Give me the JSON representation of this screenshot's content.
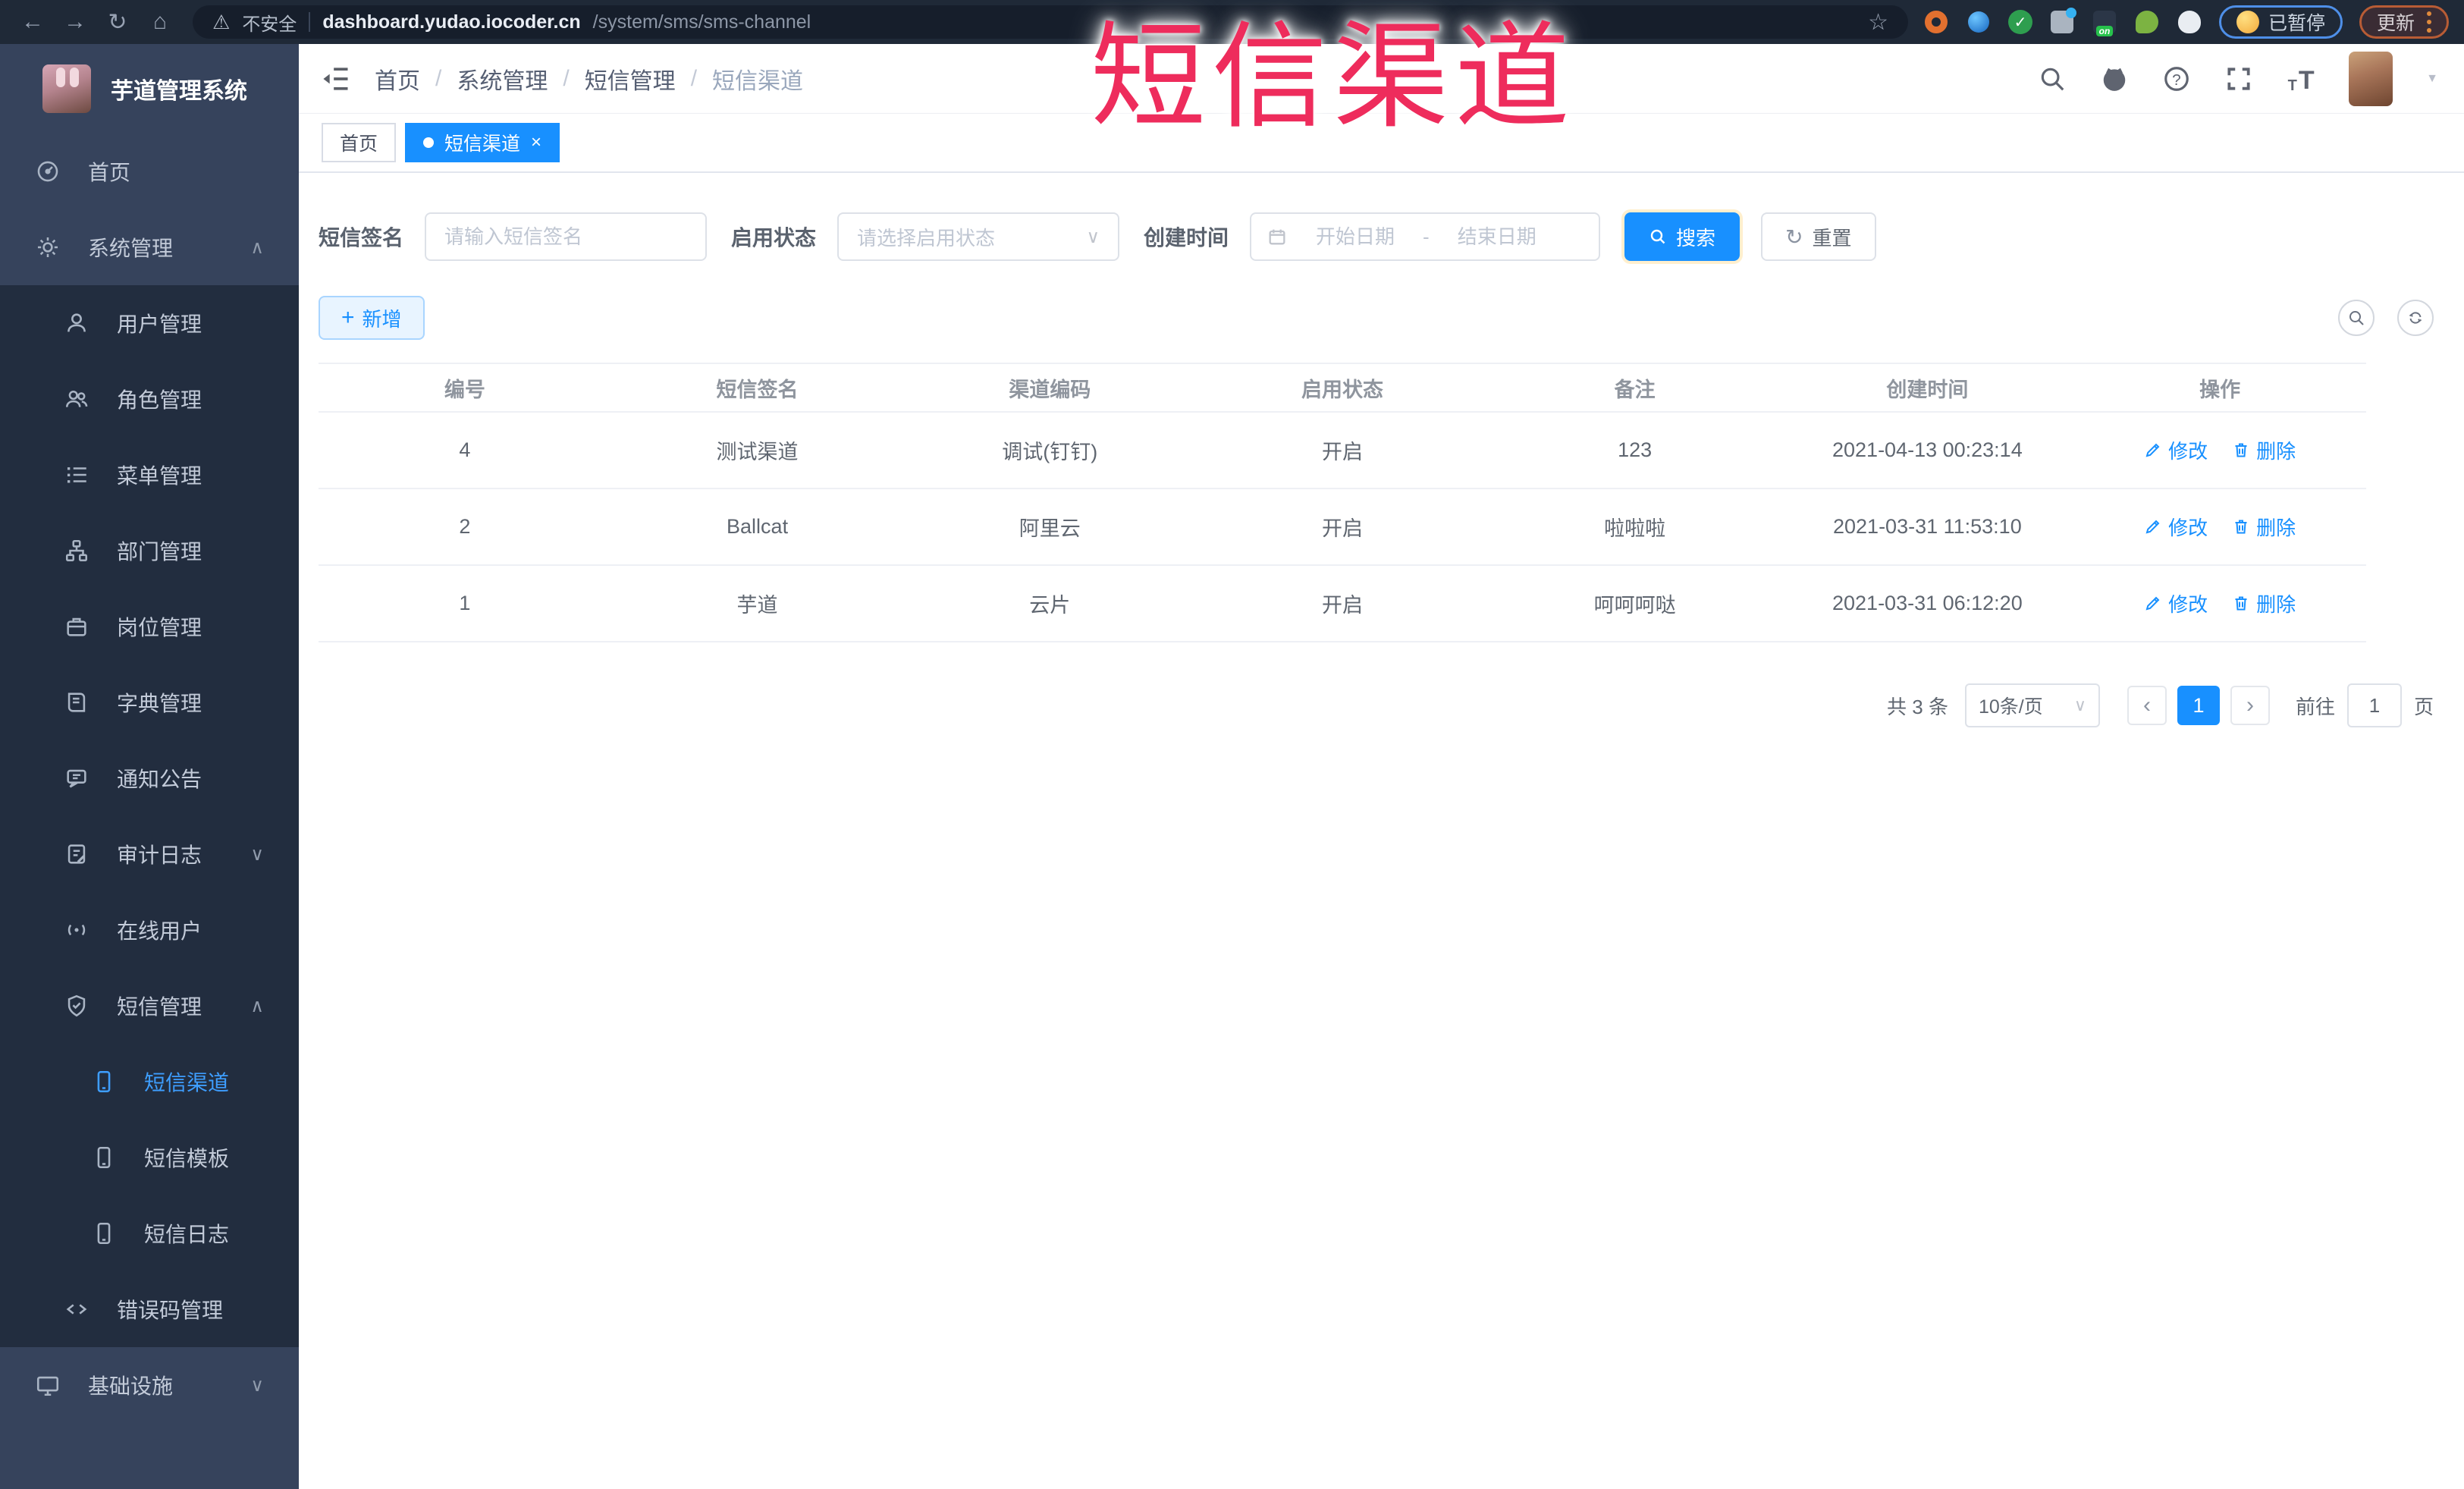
{
  "browser": {
    "security_label": "不安全",
    "url_host": "dashboard.yudao.iocoder.cn",
    "url_path": "/system/sms/sms-channel",
    "paused_badge": "已暂停",
    "update_button": "更新"
  },
  "overlay_title": "短信渠道",
  "icons": {
    "back": "←",
    "forward": "→",
    "reload": "↻",
    "home": "⌂",
    "warning": "⚠",
    "star": "☆",
    "check": "✓",
    "on_badge": "on",
    "caret_up": "∧",
    "caret_down": "∨",
    "select_caret": "∨",
    "close": "×",
    "plus": "+",
    "dash": "-",
    "chevron_left": "‹",
    "chevron_right": "›",
    "avatar_caret": "▼",
    "refresh_glyph": "↻",
    "font_size": "T"
  },
  "sidebar": {
    "app_title": "芋道管理系统",
    "items": [
      {
        "label": "首页",
        "icon": "dashboard",
        "level": 1,
        "dark": false,
        "caret": "",
        "active": false
      },
      {
        "label": "系统管理",
        "icon": "gear",
        "level": 1,
        "dark": false,
        "caret": "up",
        "active": false
      },
      {
        "label": "用户管理",
        "icon": "user",
        "level": 2,
        "dark": true,
        "caret": "",
        "active": false
      },
      {
        "label": "角色管理",
        "icon": "users",
        "level": 2,
        "dark": true,
        "caret": "",
        "active": false
      },
      {
        "label": "菜单管理",
        "icon": "menu-list",
        "level": 2,
        "dark": true,
        "caret": "",
        "active": false
      },
      {
        "label": "部门管理",
        "icon": "org-tree",
        "level": 2,
        "dark": true,
        "caret": "",
        "active": false
      },
      {
        "label": "岗位管理",
        "icon": "badge",
        "level": 2,
        "dark": true,
        "caret": "",
        "active": false
      },
      {
        "label": "字典管理",
        "icon": "book",
        "level": 2,
        "dark": true,
        "caret": "",
        "active": false
      },
      {
        "label": "通知公告",
        "icon": "chat",
        "level": 2,
        "dark": true,
        "caret": "",
        "active": false
      },
      {
        "label": "审计日志",
        "icon": "log",
        "level": 2,
        "dark": true,
        "caret": "down",
        "active": false
      },
      {
        "label": "在线用户",
        "icon": "online",
        "level": 2,
        "dark": true,
        "caret": "",
        "active": false
      },
      {
        "label": "短信管理",
        "icon": "shield",
        "level": 2,
        "dark": true,
        "caret": "up",
        "active": false
      },
      {
        "label": "短信渠道",
        "icon": "phone",
        "level": 3,
        "dark": true,
        "caret": "",
        "active": true
      },
      {
        "label": "短信模板",
        "icon": "phone",
        "level": 3,
        "dark": true,
        "caret": "",
        "active": false
      },
      {
        "label": "短信日志",
        "icon": "phone",
        "level": 3,
        "dark": true,
        "caret": "",
        "active": false
      },
      {
        "label": "错误码管理",
        "icon": "code",
        "level": 2,
        "dark": true,
        "caret": "",
        "active": false
      },
      {
        "label": "基础设施",
        "icon": "monitor",
        "level": 1,
        "dark": false,
        "caret": "down",
        "active": false
      }
    ]
  },
  "breadcrumb": {
    "separator": "/",
    "items": [
      "首页",
      "系统管理",
      "短信管理",
      "短信渠道"
    ]
  },
  "tabs": [
    {
      "label": "首页",
      "active": false
    },
    {
      "label": "短信渠道",
      "active": true
    }
  ],
  "filters": {
    "sign_label": "短信签名",
    "sign_placeholder": "请输入短信签名",
    "status_label": "启用状态",
    "status_placeholder": "请选择启用状态",
    "time_label": "创建时间",
    "date_start_placeholder": "开始日期",
    "date_separator": "-",
    "date_end_placeholder": "结束日期",
    "search_label": "搜索",
    "reset_label": "重置"
  },
  "toolbar": {
    "add_label": "新增"
  },
  "table": {
    "columns": [
      "编号",
      "短信签名",
      "渠道编码",
      "启用状态",
      "备注",
      "创建时间",
      "操作"
    ],
    "rows": [
      {
        "id": "4",
        "sign": "测试渠道",
        "code": "调试(钉钉)",
        "status": "开启",
        "remark": "123",
        "created": "2021-04-13 00:23:14"
      },
      {
        "id": "2",
        "sign": "Ballcat",
        "code": "阿里云",
        "status": "开启",
        "remark": "啦啦啦",
        "created": "2021-03-31 11:53:10"
      },
      {
        "id": "1",
        "sign": "芋道",
        "code": "云片",
        "status": "开启",
        "remark": "呵呵呵哒",
        "created": "2021-03-31 06:12:20"
      }
    ],
    "edit_label": "修改",
    "delete_label": "删除"
  },
  "pagination": {
    "total_text": "共 3 条",
    "page_size": "10条/页",
    "current_page": "1",
    "goto_label": "前往",
    "goto_value": "1",
    "page_label": "页"
  },
  "colors": {
    "theme_blue": "#1890ff",
    "sidebar_bg": "#36435c",
    "submenu_bg": "#222d3f",
    "overlay_red": "#ee2c5c"
  }
}
